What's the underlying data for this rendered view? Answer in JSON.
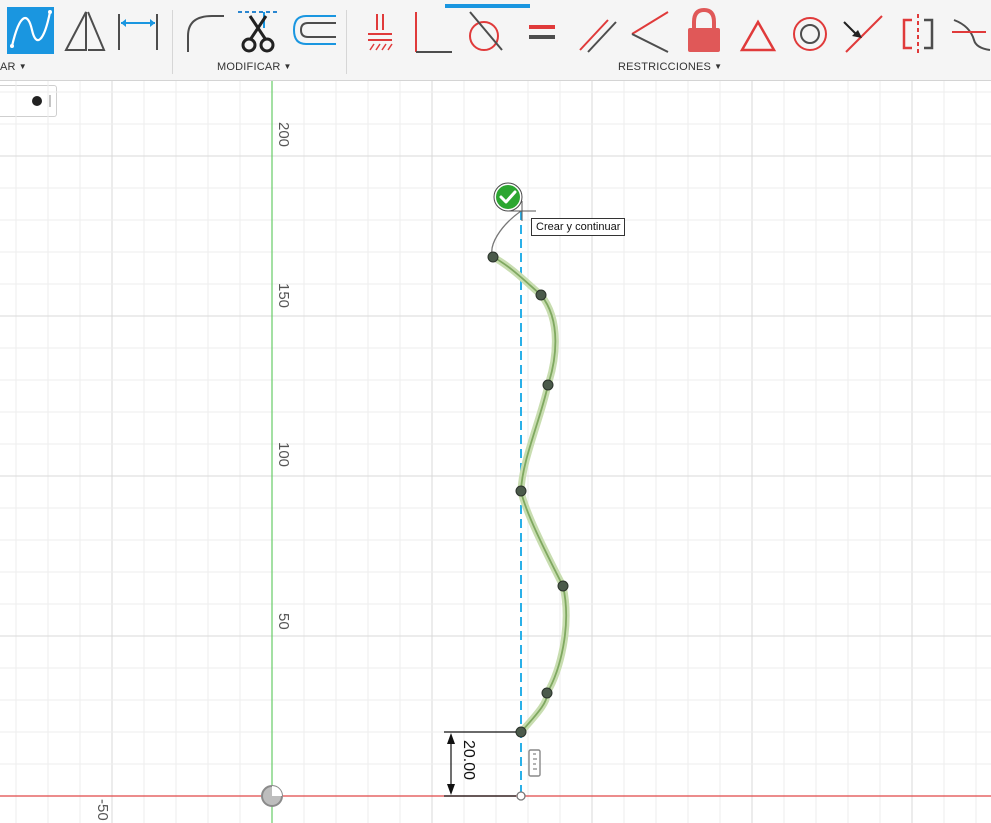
{
  "toolbar": {
    "groups": [
      {
        "label": "AR"
      },
      {
        "label": "MODIFICAR"
      },
      {
        "label": "RESTRICCIONES"
      }
    ],
    "tools": [
      {
        "icon": "spline-icon",
        "active": true
      },
      {
        "icon": "triangle-icon"
      },
      {
        "icon": "dimension-icon"
      },
      {
        "icon": "fillet-icon"
      },
      {
        "icon": "trim-scissors-icon"
      },
      {
        "icon": "offset-icon"
      },
      {
        "icon": "fix-constraint-icon"
      },
      {
        "icon": "perpendicular-icon"
      },
      {
        "icon": "tangent-icon"
      },
      {
        "icon": "equal-icon"
      },
      {
        "icon": "parallel-icon"
      },
      {
        "icon": "coincident-icon"
      },
      {
        "icon": "lock-icon"
      },
      {
        "icon": "triangle-outline-icon"
      },
      {
        "icon": "concentric-icon"
      },
      {
        "icon": "midpoint-icon"
      },
      {
        "icon": "symmetry-icon"
      },
      {
        "icon": "curvature-icon"
      }
    ],
    "colors": {
      "accent": "#1a96e0",
      "constraint_red": "#e03a3a",
      "icon_gray": "#4d4d4d"
    }
  },
  "canvas": {
    "axis_labels": {
      "y200": "200",
      "y150": "150",
      "y100": "100",
      "y50": "50",
      "x_neg50": "-50"
    },
    "tooltip": "Crear y continuar",
    "dimension": "20.00",
    "colors": {
      "spline": "#9dc37a",
      "construction": "#2ab0e8",
      "x_axis": "#e04848",
      "y_axis": "#66cc66"
    }
  }
}
